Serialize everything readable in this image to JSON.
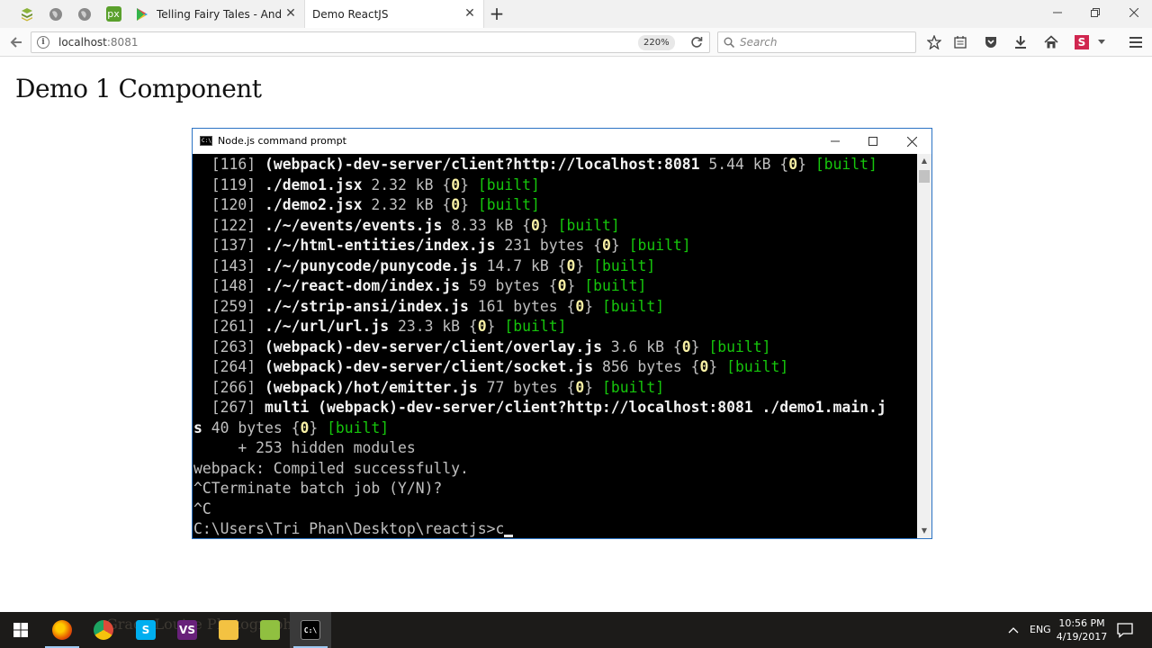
{
  "browser": {
    "pinned_tabs": [
      {
        "icon": "bookmark-icon",
        "color": "#8bb33b"
      },
      {
        "icon": "globe-icon",
        "color": "#888888"
      },
      {
        "icon": "globe-icon",
        "color": "#888888"
      },
      {
        "icon": "pixlr-icon",
        "label": "px",
        "color": "#5aa02c"
      }
    ],
    "tabs": [
      {
        "label": "Telling Fairy Tales - Andro...",
        "icon": "google-play-icon",
        "active": false
      },
      {
        "label": "Demo ReactJS",
        "active": true
      }
    ],
    "new_tab_label": "+",
    "url_host": "localhost",
    "url_port": ":8081",
    "zoom": "220%",
    "search_placeholder": "Search"
  },
  "page": {
    "title": "Demo 1 Component"
  },
  "console": {
    "title": "Node.js command prompt",
    "icon_text": "C:\\",
    "lines": [
      [
        {
          "t": "  [116] ",
          "c": "n"
        },
        {
          "t": "(webpack)-dev-server/client?http://localhost:8081",
          "c": "w"
        },
        {
          "t": " 5.44 kB ",
          "c": "n"
        },
        {
          "t": "{",
          "c": "n"
        },
        {
          "t": "0",
          "c": "y"
        },
        {
          "t": "} ",
          "c": "n"
        },
        {
          "t": "[built]",
          "c": "g"
        }
      ],
      [
        {
          "t": "  [119] ",
          "c": "n"
        },
        {
          "t": "./demo1.jsx",
          "c": "w"
        },
        {
          "t": " 2.32 kB ",
          "c": "n"
        },
        {
          "t": "{",
          "c": "n"
        },
        {
          "t": "0",
          "c": "y"
        },
        {
          "t": "} ",
          "c": "n"
        },
        {
          "t": "[built]",
          "c": "g"
        }
      ],
      [
        {
          "t": "  [120] ",
          "c": "n"
        },
        {
          "t": "./demo2.jsx",
          "c": "w"
        },
        {
          "t": " 2.32 kB ",
          "c": "n"
        },
        {
          "t": "{",
          "c": "n"
        },
        {
          "t": "0",
          "c": "y"
        },
        {
          "t": "} ",
          "c": "n"
        },
        {
          "t": "[built]",
          "c": "g"
        }
      ],
      [
        {
          "t": "  [122] ",
          "c": "n"
        },
        {
          "t": "./~/events/events.js",
          "c": "w"
        },
        {
          "t": " 8.33 kB ",
          "c": "n"
        },
        {
          "t": "{",
          "c": "n"
        },
        {
          "t": "0",
          "c": "y"
        },
        {
          "t": "} ",
          "c": "n"
        },
        {
          "t": "[built]",
          "c": "g"
        }
      ],
      [
        {
          "t": "  [137] ",
          "c": "n"
        },
        {
          "t": "./~/html-entities/index.js",
          "c": "w"
        },
        {
          "t": " 231 bytes ",
          "c": "n"
        },
        {
          "t": "{",
          "c": "n"
        },
        {
          "t": "0",
          "c": "y"
        },
        {
          "t": "} ",
          "c": "n"
        },
        {
          "t": "[built]",
          "c": "g"
        }
      ],
      [
        {
          "t": "  [143] ",
          "c": "n"
        },
        {
          "t": "./~/punycode/punycode.js",
          "c": "w"
        },
        {
          "t": " 14.7 kB ",
          "c": "n"
        },
        {
          "t": "{",
          "c": "n"
        },
        {
          "t": "0",
          "c": "y"
        },
        {
          "t": "} ",
          "c": "n"
        },
        {
          "t": "[built]",
          "c": "g"
        }
      ],
      [
        {
          "t": "  [148] ",
          "c": "n"
        },
        {
          "t": "./~/react-dom/index.js",
          "c": "w"
        },
        {
          "t": " 59 bytes ",
          "c": "n"
        },
        {
          "t": "{",
          "c": "n"
        },
        {
          "t": "0",
          "c": "y"
        },
        {
          "t": "} ",
          "c": "n"
        },
        {
          "t": "[built]",
          "c": "g"
        }
      ],
      [
        {
          "t": "  [259] ",
          "c": "n"
        },
        {
          "t": "./~/strip-ansi/index.js",
          "c": "w"
        },
        {
          "t": " 161 bytes ",
          "c": "n"
        },
        {
          "t": "{",
          "c": "n"
        },
        {
          "t": "0",
          "c": "y"
        },
        {
          "t": "} ",
          "c": "n"
        },
        {
          "t": "[built]",
          "c": "g"
        }
      ],
      [
        {
          "t": "  [261] ",
          "c": "n"
        },
        {
          "t": "./~/url/url.js",
          "c": "w"
        },
        {
          "t": " 23.3 kB ",
          "c": "n"
        },
        {
          "t": "{",
          "c": "n"
        },
        {
          "t": "0",
          "c": "y"
        },
        {
          "t": "} ",
          "c": "n"
        },
        {
          "t": "[built]",
          "c": "g"
        }
      ],
      [
        {
          "t": "  [263] ",
          "c": "n"
        },
        {
          "t": "(webpack)-dev-server/client/overlay.js",
          "c": "w"
        },
        {
          "t": " 3.6 kB ",
          "c": "n"
        },
        {
          "t": "{",
          "c": "n"
        },
        {
          "t": "0",
          "c": "y"
        },
        {
          "t": "} ",
          "c": "n"
        },
        {
          "t": "[built]",
          "c": "g"
        }
      ],
      [
        {
          "t": "  [264] ",
          "c": "n"
        },
        {
          "t": "(webpack)-dev-server/client/socket.js",
          "c": "w"
        },
        {
          "t": " 856 bytes ",
          "c": "n"
        },
        {
          "t": "{",
          "c": "n"
        },
        {
          "t": "0",
          "c": "y"
        },
        {
          "t": "} ",
          "c": "n"
        },
        {
          "t": "[built]",
          "c": "g"
        }
      ],
      [
        {
          "t": "  [266] ",
          "c": "n"
        },
        {
          "t": "(webpack)/hot/emitter.js",
          "c": "w"
        },
        {
          "t": " 77 bytes ",
          "c": "n"
        },
        {
          "t": "{",
          "c": "n"
        },
        {
          "t": "0",
          "c": "y"
        },
        {
          "t": "} ",
          "c": "n"
        },
        {
          "t": "[built]",
          "c": "g"
        }
      ],
      [
        {
          "t": "  [267] ",
          "c": "n"
        },
        {
          "t": "multi (webpack)-dev-server/client?http://localhost:8081 ./demo1.main.j",
          "c": "w"
        }
      ],
      [
        {
          "t": "s",
          "c": "w"
        },
        {
          "t": " 40 bytes ",
          "c": "n"
        },
        {
          "t": "{",
          "c": "n"
        },
        {
          "t": "0",
          "c": "y"
        },
        {
          "t": "} ",
          "c": "n"
        },
        {
          "t": "[built]",
          "c": "g"
        }
      ],
      [
        {
          "t": "     + 253 hidden modules",
          "c": "n"
        }
      ],
      [
        {
          "t": "webpack: Compiled successfully.",
          "c": "n"
        }
      ],
      [
        {
          "t": "^CTerminate batch job (Y/N)?",
          "c": "n"
        }
      ],
      [
        {
          "t": "^C",
          "c": "n"
        }
      ],
      [
        {
          "t": "C:\\Users\\Tri Phan\\Desktop\\reactjs>c",
          "c": "n"
        },
        {
          "cursor": true
        }
      ]
    ]
  },
  "taskbar": {
    "background_text": "Grace Louise Photography",
    "apps": [
      {
        "name": "firefox-icon",
        "color": "#e66000",
        "label": "",
        "state": "running"
      },
      {
        "name": "chrome-icon",
        "color": "#dd4b39",
        "label": "",
        "state": ""
      },
      {
        "name": "skype-icon",
        "color": "#00aff0",
        "label": "S",
        "state": ""
      },
      {
        "name": "visual-studio-icon",
        "color": "#68217a",
        "label": "VS",
        "state": ""
      },
      {
        "name": "file-explorer-icon",
        "color": "#f3c242",
        "label": "",
        "state": ""
      },
      {
        "name": "notepad-plus-icon",
        "color": "#90c040",
        "label": "",
        "state": ""
      },
      {
        "name": "command-prompt-icon",
        "color": "#000000",
        "label": "C:\\",
        "state": "active"
      }
    ],
    "language": "ENG",
    "time": "10:56 PM",
    "date": "4/19/2017"
  }
}
